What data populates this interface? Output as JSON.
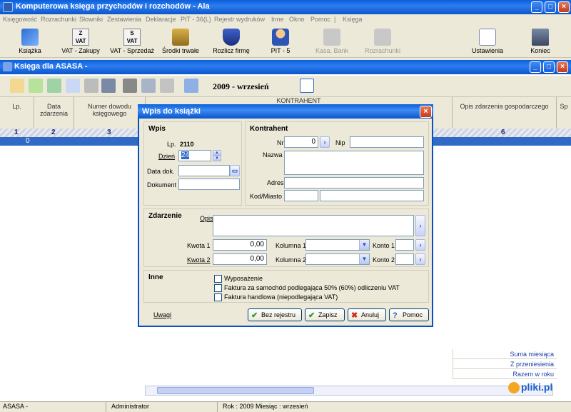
{
  "app": {
    "title": "Komputerowa księga przychodów i rozchodów - Ala"
  },
  "menu": [
    "Księgowość",
    "Rozrachunki",
    "Słowniki",
    "Zestawienia",
    "Deklaracje",
    "PIT - 36(L)",
    "Rejestr wydruków",
    "Inne",
    "Okno",
    "Pomoc",
    "|",
    "Księga"
  ],
  "toolbar": {
    "ksiazka": "Książka",
    "vat_zakupy": "VAT - Zakupy",
    "vat_sprzedaz": "VAT - Sprzedaż",
    "srodki": "Środki trwałe",
    "rozlicz": "Rozlicz firmę",
    "pit5": "PIT - 5",
    "kasa": "Kasa, Bank",
    "rozrachunki": "Rozrachunki",
    "ustawienia": "Ustawienia",
    "koniec": "Koniec"
  },
  "child": {
    "title": "Księga dla ASASA -",
    "period": "2009 - wrzesień",
    "columns": {
      "lp": "Lp.",
      "data": "Data zdarzenia",
      "numer": "Numer dowodu księgowego",
      "kontrahent": "KONTRAHENT",
      "opis": "Opis zdarzenia gospodarczego",
      "sp": "Sp"
    },
    "col_numbers": [
      "1",
      "2",
      "3",
      "6"
    ],
    "selected_lp": "0",
    "sums": [
      "Suma miesiąca",
      "Z przeniesienia",
      "Razem w roku"
    ]
  },
  "dialog": {
    "title": "Wpis do książki",
    "wpis": {
      "heading": "Wpis",
      "lp_label": "Lp.",
      "lp_value": "2110",
      "dzien_label": "Dzień",
      "dzien_value": "24",
      "data_dok_label": "Data dok.",
      "dokument_label": "Dokument"
    },
    "kontrahent": {
      "heading": "Kontrahent",
      "nr_label": "Nr",
      "nr_value": "0",
      "nip_label": "Nip",
      "nazwa_label": "Nazwa",
      "adres_label": "Adres",
      "kod_label": "Kod/Miasto"
    },
    "zdarzenie": {
      "heading": "Zdarzenie",
      "opis_label": "Opis",
      "kwota1_label": "Kwota 1",
      "kwota1_value": "0,00",
      "kwota2_label": "Kwota 2",
      "kwota2_value": "0,00",
      "kolumna1_label": "Kolumna 1",
      "kolumna2_label": "Kolumna 2",
      "konto1_label": "Konto 1",
      "konto2_label": "Konto 2"
    },
    "inne": {
      "heading": "Inne",
      "wyposazenie": "Wyposażenie",
      "samochod": "Faktura za samochód podlegająca 50% (60%) odliczeniu VAT",
      "handlowa": "Faktura handlowa (niepodlegająca VAT)"
    },
    "buttons": {
      "uwagi": "Uwagi",
      "bez_rejestru": "Bez rejestru",
      "zapisz": "Zapisz",
      "anuluj": "Anuluj",
      "pomoc": "Pomoc"
    }
  },
  "status": {
    "firma": "ASASA -",
    "user": "Administrator",
    "rok": "Rok : 2009  Miesiąc : wrzesień"
  },
  "watermark": "pliki.pl",
  "colors": {
    "titlebar": "#0a5fd8",
    "selection": "#316ac5",
    "dialog_border": "#0a4fc4"
  }
}
